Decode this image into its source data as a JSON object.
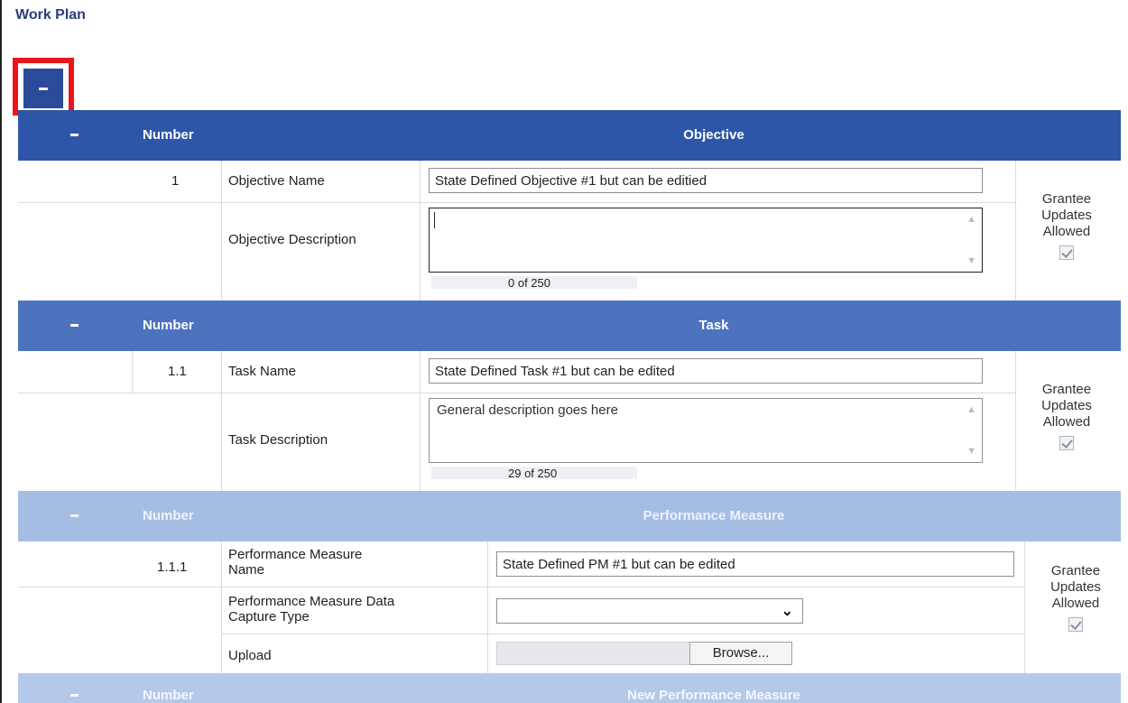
{
  "page": {
    "title": "Work Plan"
  },
  "objective_section": {
    "header": {
      "number_label": "Number",
      "title": "Objective"
    },
    "number": "1",
    "name_label": "Objective Name",
    "name_value": "State Defined Objective #1 but can be editied",
    "description_label": "Objective Description",
    "description_value": "",
    "counter": "0 of 250",
    "grantee": {
      "line1": "Grantee",
      "line2": "Updates",
      "line3": "Allowed",
      "checked": true
    }
  },
  "task_section": {
    "header": {
      "number_label": "Number",
      "title": "Task"
    },
    "number": "1.1",
    "name_label": "Task Name",
    "name_value": "State Defined Task #1 but can be edited",
    "description_label": "Task Description",
    "description_value": "General description goes here",
    "counter": "29 of 250",
    "grantee": {
      "line1": "Grantee",
      "line2": "Updates",
      "line3": "Allowed",
      "checked": true
    }
  },
  "pm_section": {
    "header": {
      "number_label": "Number",
      "title": "Performance Measure"
    },
    "number": "1.1.1",
    "name_label_line1": "Performance Measure",
    "name_label_line2": "Name",
    "name_value": "State Defined PM #1 but can be edited",
    "capture_label_line1": "Performance Measure Data",
    "capture_label_line2": "Capture Type",
    "capture_value": "",
    "upload_label": "Upload",
    "browse_label": "Browse...",
    "grantee": {
      "line1": "Grantee",
      "line2": "Updates",
      "line3": "Allowed",
      "checked": true
    }
  },
  "new_pm_section": {
    "header": {
      "number_label": "Number",
      "title": "New Performance Measure"
    }
  },
  "icons": {
    "collapse": "minus-icon",
    "caret": "chevron-down-icon",
    "check": "check-icon"
  },
  "colors": {
    "header_dark": "#2e56a8",
    "header_mid": "#4d73bf",
    "header_light": "#a6bde3",
    "highlight": "#e8161b"
  }
}
